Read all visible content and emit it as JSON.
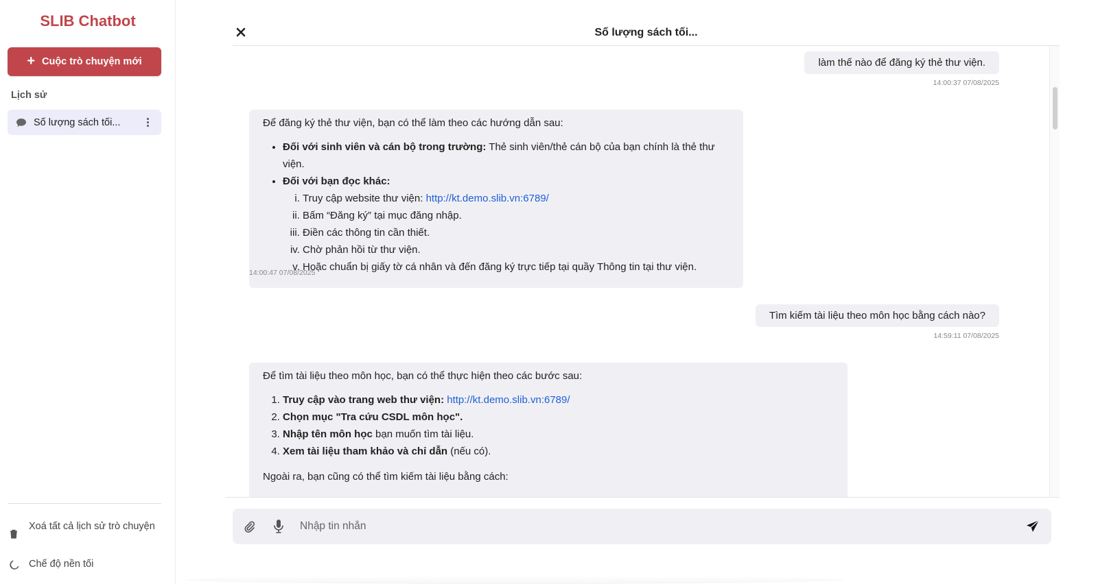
{
  "sidebar": {
    "app_title": "SLIB Chatbot",
    "new_chat_label": "Cuộc trò chuyện mới",
    "history_label": "Lịch sử",
    "history_items": [
      {
        "label": "Số lượng sách tối..."
      }
    ],
    "clear_all_label": "Xoá tất cả lịch sử trò chuyện",
    "dark_mode_label": "Chế độ nền tối"
  },
  "header": {
    "title": "Số lượng sách tối..."
  },
  "messages": [
    {
      "role": "user",
      "text": "làm thế nào để đăng ký thẻ thư viện.",
      "timestamp": "14:00:37 07/08/2025"
    },
    {
      "role": "bot",
      "intro": "Để đăng ký thẻ thư viện, bạn có thể làm theo các hướng dẫn sau:",
      "bullets": [
        {
          "bold": "Đối với sinh viên và cán bộ trong trường:",
          "text": " Thẻ sinh viên/thẻ cán bộ của bạn chính là thẻ thư viện."
        },
        {
          "bold": "Đối với bạn đọc khác:",
          "text": ""
        }
      ],
      "steps": [
        {
          "text": "Truy cập website thư viện: ",
          "link": "http://kt.demo.slib.vn:6789/"
        },
        {
          "text": "Bấm “Đăng ký” tại mục đăng nhập."
        },
        {
          "text": "Điền các thông tin cần thiết."
        },
        {
          "text": "Chờ phản hồi từ thư viện."
        },
        {
          "text": "Hoặc chuẩn bị giấy tờ cá nhân và đến đăng ký trực tiếp tại quầy Thông tin tại thư viện."
        }
      ],
      "timestamp": "14:00:47 07/08/2025"
    },
    {
      "role": "user",
      "text": "Tìm kiếm tài liệu theo môn học bằng cách nào?",
      "timestamp": "14:59:11 07/08/2025"
    },
    {
      "role": "bot",
      "intro": "Để tìm tài liệu theo môn học, bạn có thể thực hiện theo các bước sau:",
      "steps": [
        {
          "bold": "Truy cập vào trang web thư viện:",
          "text": " ",
          "link": "http://kt.demo.slib.vn:6789/"
        },
        {
          "bold": "Chọn mục \"Tra cứu CSDL môn học\".",
          "text": ""
        },
        {
          "bold": "Nhập tên môn học",
          "text": " bạn muốn tìm tài liệu."
        },
        {
          "bold": "Xem tài liệu tham khảo và chỉ dẫn",
          "text": " (nếu có)."
        }
      ],
      "outro": "Ngoài ra, bạn cũng có thể tìm kiếm tài liệu bằng cách:"
    }
  ],
  "composer": {
    "placeholder": "Nhập tin nhắn",
    "value": ""
  },
  "colors": {
    "brand": "#c0464b",
    "bubble": "#f0f0f4",
    "history_active": "#ececfa",
    "link": "#1e5fd6"
  },
  "icons": {
    "close": "close-icon",
    "chat": "chat-bubble-icon",
    "more": "more-vertical-icon",
    "trash": "trash-icon",
    "moon": "moon-icon",
    "attach": "paperclip-icon",
    "mic": "microphone-icon",
    "send": "send-icon",
    "plus": "plus-icon"
  }
}
